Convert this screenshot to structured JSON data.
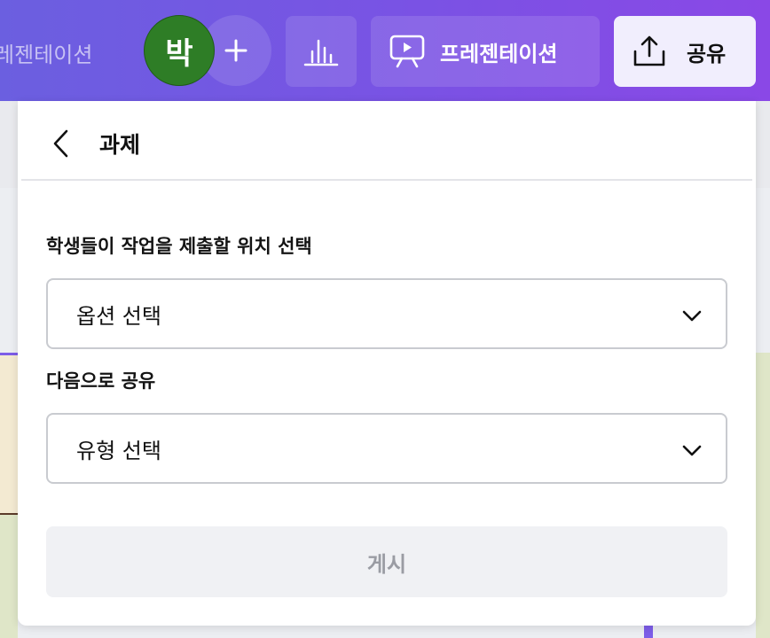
{
  "topbar": {
    "doc_title": "레젠테이션",
    "avatar_initial": "박",
    "add_collaborator_label": "+",
    "present_label": "프레젠테이션",
    "share_label": "공유",
    "accent_color": "#7a52e4"
  },
  "panel": {
    "title": "과제",
    "location_label": "학생들이 작업을 제출할 위치 선택",
    "location_select": "옵션 선택",
    "share_as_label": "다음으로 공유",
    "share_as_select": "유형 선택",
    "post_label": "게시"
  },
  "icons": [
    "chevron-left-icon",
    "chevron-down-icon",
    "bar-chart-icon",
    "presentation-icon",
    "upload-icon"
  ]
}
